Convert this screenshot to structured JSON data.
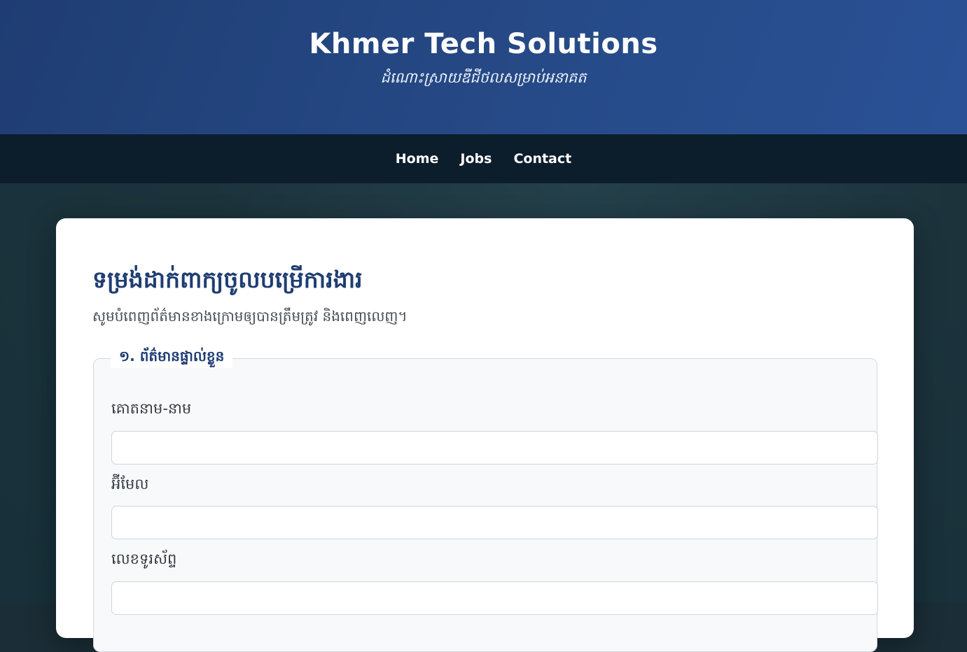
{
  "header": {
    "title": "Khmer Tech Solutions",
    "tagline": "ដំណោះស្រាយឌីជីថលសម្រាប់អនាគត"
  },
  "nav": {
    "items": [
      "Home",
      "Jobs",
      "Contact"
    ]
  },
  "form": {
    "title": "ទម្រង់ដាក់ពាក្យចូលបម្រើការងារ",
    "subtitle": "សូមបំពេញព័ត៌មានខាងក្រោមឲ្យបានត្រឹមត្រូវ និងពេញលេញ។",
    "section1": {
      "legend": "១. ព័ត៌មានផ្ទាល់ខ្លួន",
      "fields": [
        {
          "label": "គោតនាម-នាម",
          "value": ""
        },
        {
          "label": "អ៊ីមែល",
          "value": ""
        },
        {
          "label": "លេខទូរស័ព្ទ",
          "value": ""
        }
      ]
    }
  },
  "colors": {
    "header_bg": "#264a87",
    "nav_bg": "#0c1d2c",
    "accent": "#1f3d73",
    "page_bg": "#1c333c"
  }
}
